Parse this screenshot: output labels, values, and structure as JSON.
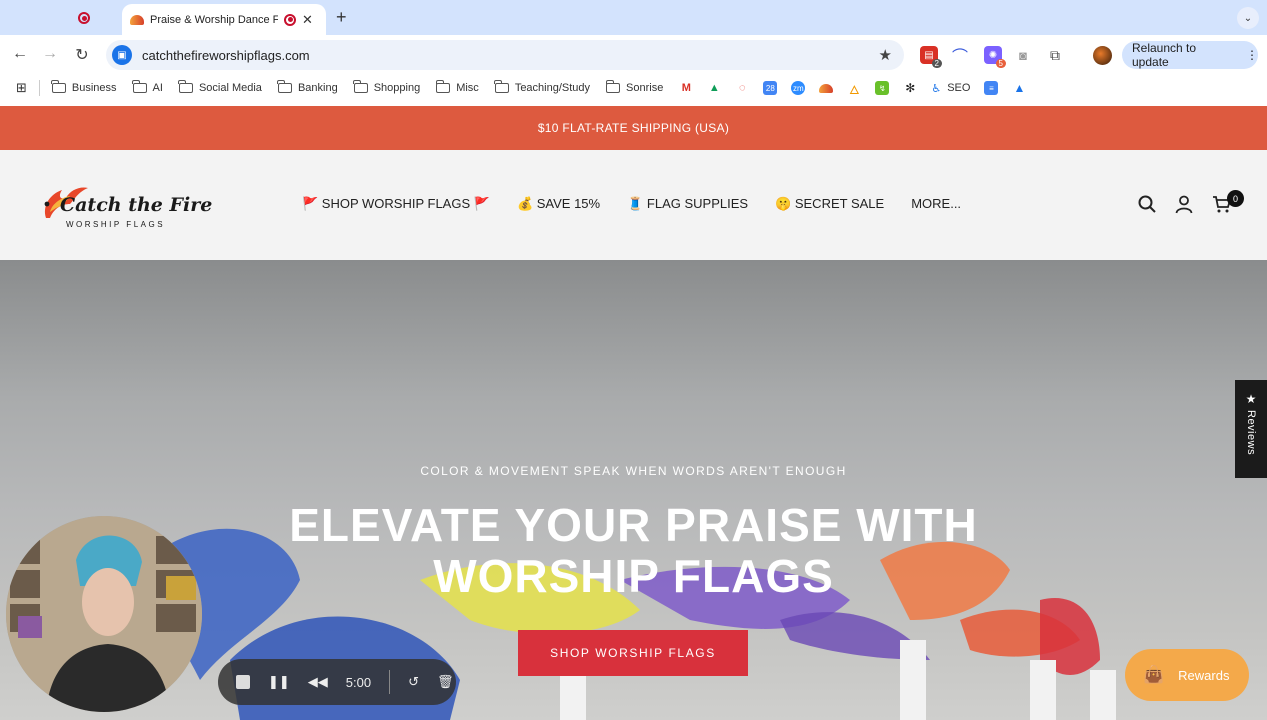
{
  "browser": {
    "active_tab_title": "Praise & Worship Dance F",
    "url": "catchthefireworshipflags.com",
    "relaunch_label": "Relaunch to update",
    "extension_badges": {
      "first": "2",
      "second": "5"
    }
  },
  "bookmarks": {
    "folders": [
      "Business",
      "AI",
      "Social Media",
      "Banking",
      "Shopping",
      "Misc",
      "Teaching/Study",
      "Sonrise"
    ],
    "seo_label": "SEO"
  },
  "site": {
    "announcement": "$10 FLAT-RATE SHIPPING (USA)",
    "logo_text": "Catch the Fire",
    "logo_subtext": "WORSHIP FLAGS",
    "nav": [
      "🚩 SHOP WORSHIP FLAGS 🚩",
      "💰 SAVE 15%",
      "🧵 FLAG SUPPLIES",
      "🤫 SECRET SALE",
      "MORE..."
    ],
    "cart_count": "0"
  },
  "hero": {
    "eyebrow": "COLOR & MOVEMENT SPEAK WHEN WORDS AREN'T ENOUGH",
    "title_line1": "ELEVATE YOUR PRAISE WITH",
    "title_line2": "WORSHIP FLAGS",
    "cta": "SHOP WORSHIP FLAGS"
  },
  "widgets": {
    "reviews_label": "Reviews",
    "rewards_label": "Rewards",
    "recorder_time": "5:00"
  },
  "colors": {
    "announcement_bg": "#dd5a3f",
    "cta_bg": "#d8313c",
    "rewards_bg": "#f4a94a"
  }
}
